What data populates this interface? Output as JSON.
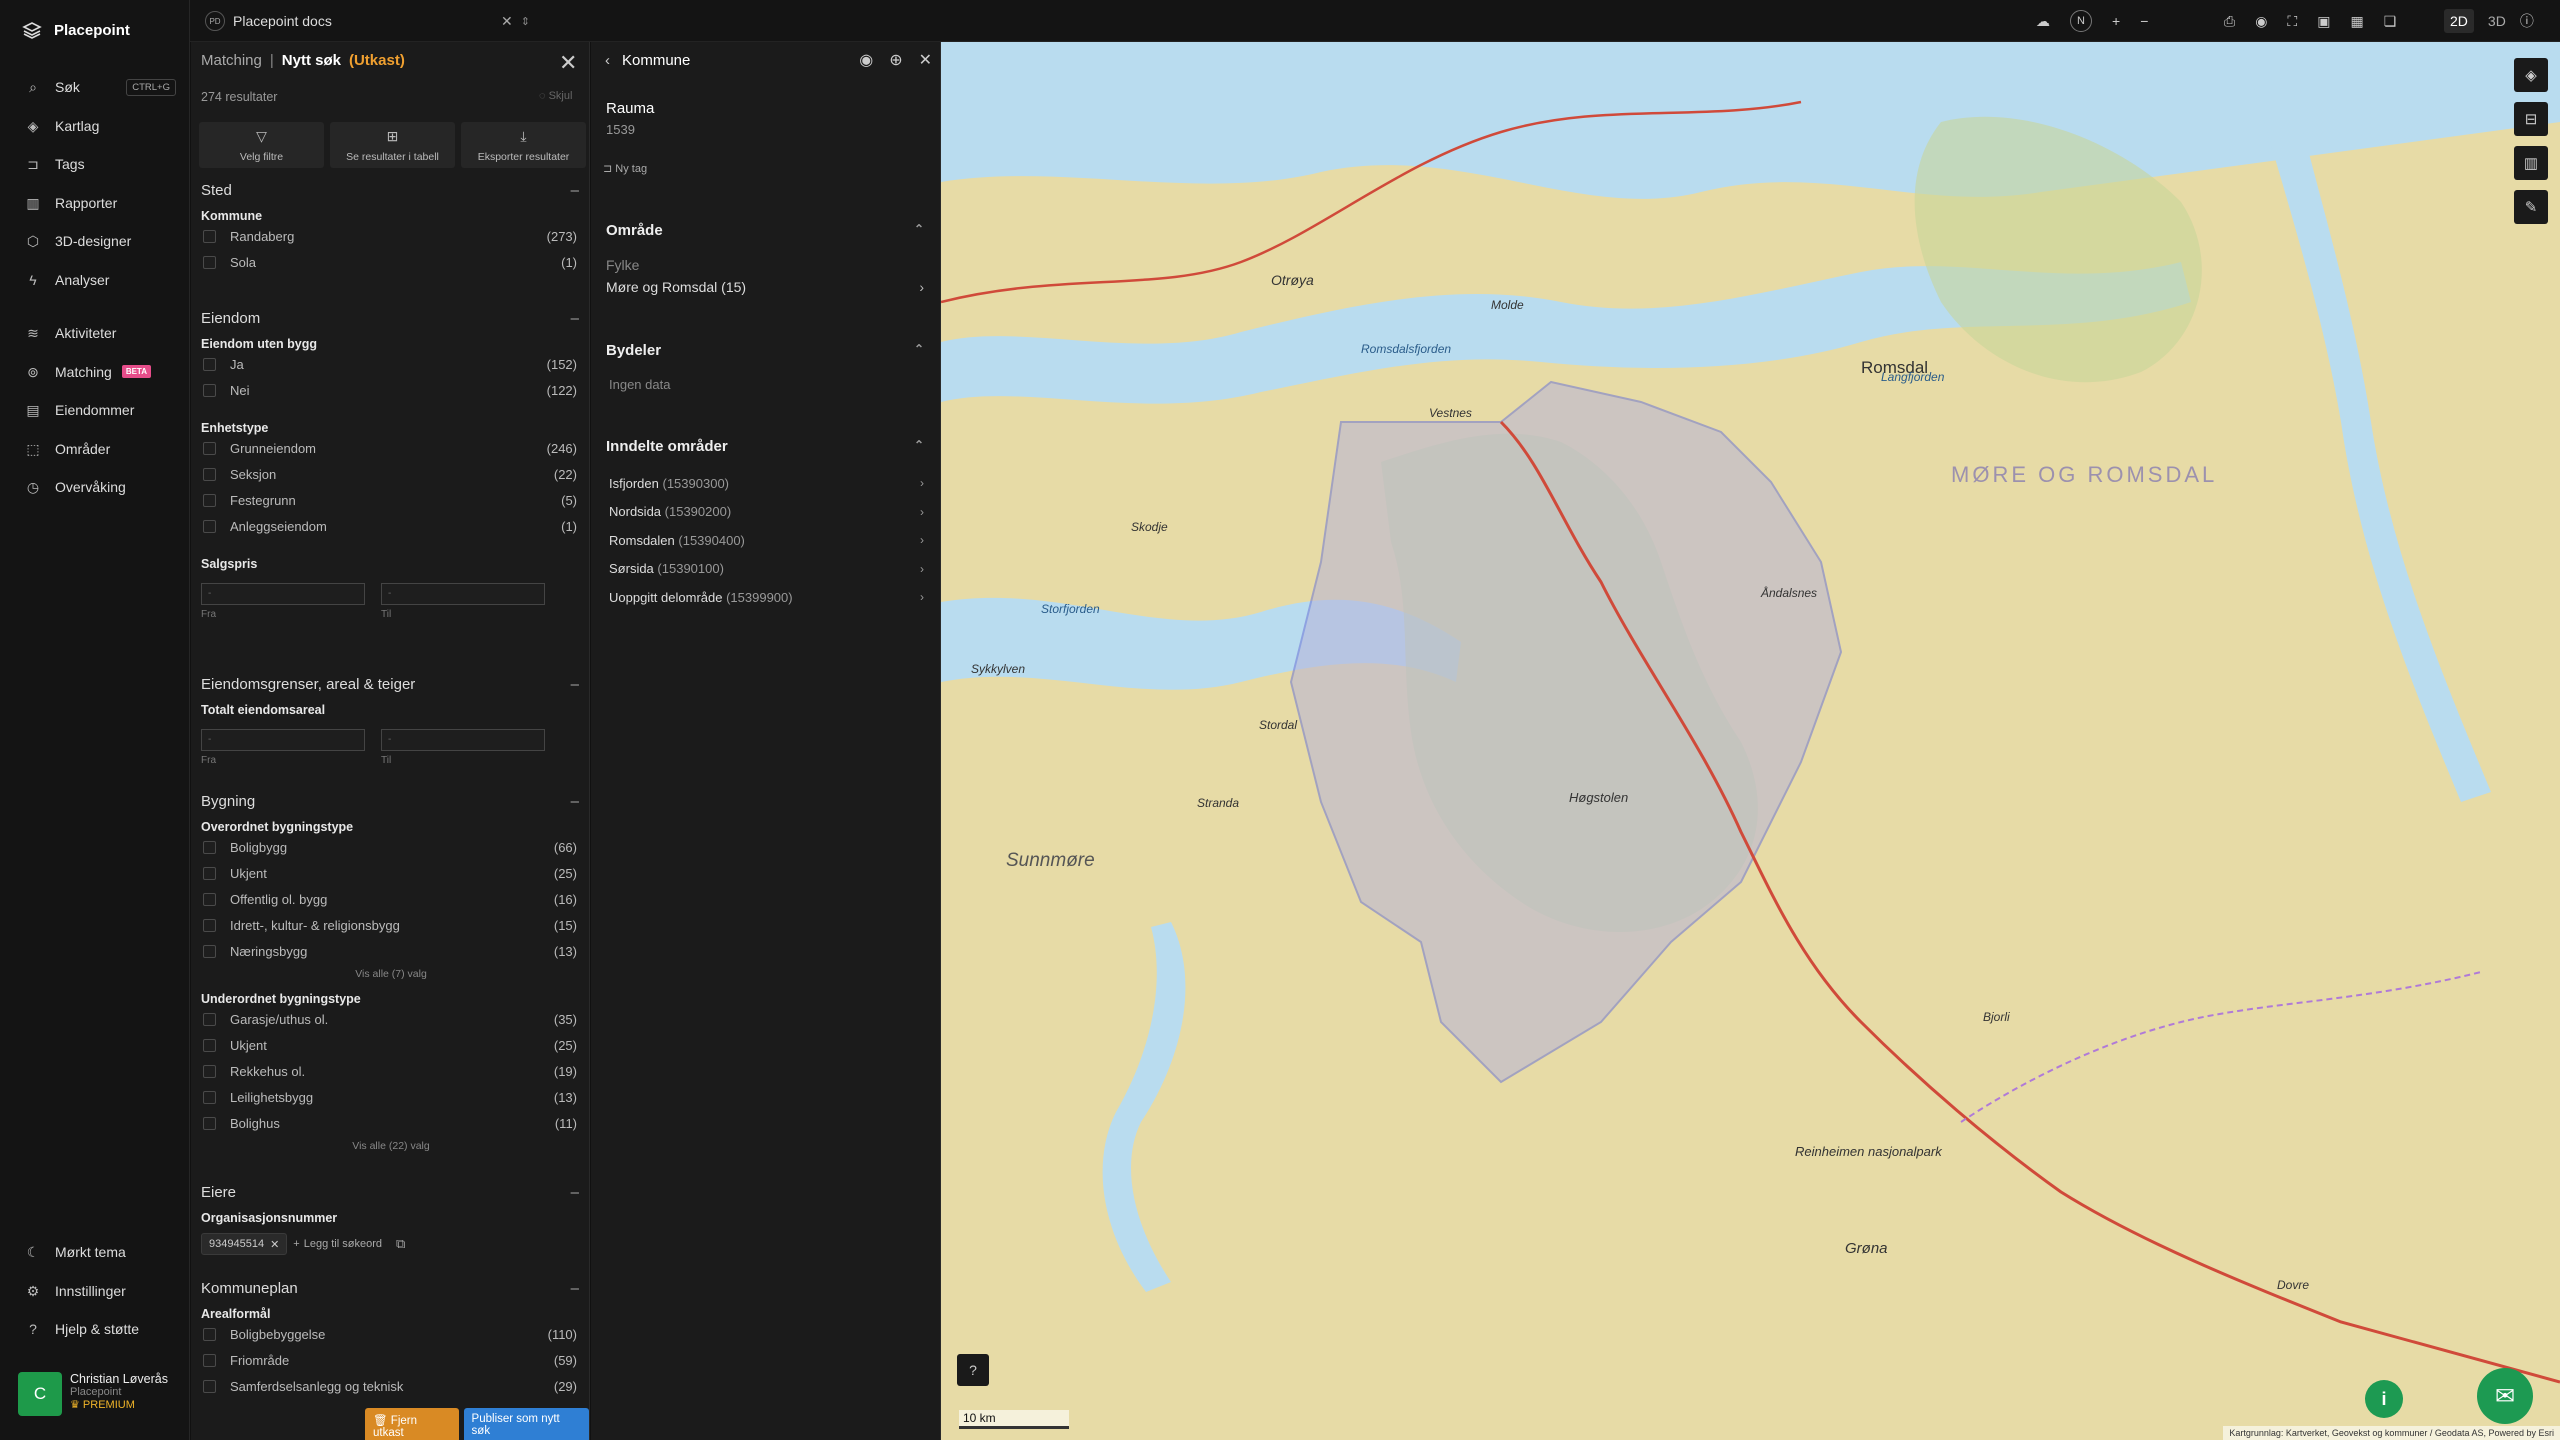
{
  "app": {
    "name": "Placepoint"
  },
  "sidebar": {
    "items": [
      {
        "label": "Søk",
        "shortcut": "CTRL+G",
        "icon": "search-icon"
      },
      {
        "label": "Kartlag",
        "icon": "layers-icon"
      },
      {
        "label": "Tags",
        "icon": "bookmark-icon"
      },
      {
        "label": "Rapporter",
        "icon": "chart-icon"
      },
      {
        "label": "3D-designer",
        "icon": "cube-icon"
      },
      {
        "label": "Analyser",
        "icon": "lightning-icon"
      },
      {
        "label": "Aktiviteter",
        "icon": "activity-icon"
      },
      {
        "label": "Matching",
        "badge": "BETA",
        "icon": "target-icon"
      },
      {
        "label": "Eiendommer",
        "icon": "building-icon"
      },
      {
        "label": "Områder",
        "icon": "area-icon"
      },
      {
        "label": "Overvåking",
        "icon": "monitor-icon"
      }
    ],
    "bottom": [
      {
        "label": "Mørkt tema",
        "icon": "moon-icon"
      },
      {
        "label": "Innstillinger",
        "icon": "gear-icon"
      },
      {
        "label": "Hjelp & støtte",
        "icon": "help-icon"
      }
    ],
    "user": {
      "initial": "C",
      "name": "Christian Løverås",
      "org": "Placepoint",
      "plan": "PREMIUM"
    }
  },
  "topbar": {
    "doc_badge": "PD",
    "doc_name": "Placepoint docs",
    "view_2d": "2D",
    "view_3d": "3D",
    "compass": "N"
  },
  "search": {
    "breadcrumb": "Matching",
    "title": "Nytt søk",
    "status": "(Utkast)",
    "count": "274 resultater",
    "hide": "Skjul",
    "actions": [
      "Velg filtre",
      "Se resultater i tabell",
      "Eksporter resultater"
    ],
    "sted": {
      "title": "Sted",
      "kommune_label": "Kommune",
      "options": [
        {
          "label": "Randaberg",
          "count": "(273)"
        },
        {
          "label": "Sola",
          "count": "(1)"
        }
      ]
    },
    "eiendom": {
      "title": "Eiendom",
      "uten_bygg_label": "Eiendom uten bygg",
      "uten_bygg": [
        {
          "label": "Ja",
          "count": "(152)"
        },
        {
          "label": "Nei",
          "count": "(122)"
        }
      ],
      "enhetstype_label": "Enhetstype",
      "enhetstype": [
        {
          "label": "Grunneiendom",
          "count": "(246)"
        },
        {
          "label": "Seksjon",
          "count": "(22)"
        },
        {
          "label": "Festegrunn",
          "count": "(5)"
        },
        {
          "label": "Anleggseiendom",
          "count": "(1)"
        }
      ],
      "salgspris_label": "Salgspris",
      "from": "Fra",
      "to": "Til",
      "dash": "-"
    },
    "grenser": {
      "title": "Eiendomsgrenser, areal & teiger",
      "areal_label": "Totalt eiendomsareal",
      "from": "Fra",
      "to": "Til",
      "dash": "-"
    },
    "bygning": {
      "title": "Bygning",
      "over_label": "Overordnet bygningstype",
      "over": [
        {
          "label": "Boligbygg",
          "count": "(66)"
        },
        {
          "label": "Ukjent",
          "count": "(25)"
        },
        {
          "label": "Offentlig ol. bygg",
          "count": "(16)"
        },
        {
          "label": "Idrett-, kultur- & religionsbygg",
          "count": "(15)"
        },
        {
          "label": "Næringsbygg",
          "count": "(13)"
        }
      ],
      "over_more": "Vis alle (7) valg",
      "under_label": "Underordnet bygningstype",
      "under": [
        {
          "label": "Garasje/uthus ol.",
          "count": "(35)"
        },
        {
          "label": "Ukjent",
          "count": "(25)"
        },
        {
          "label": "Rekkehus ol.",
          "count": "(19)"
        },
        {
          "label": "Leilighetsbygg",
          "count": "(13)"
        },
        {
          "label": "Bolighus",
          "count": "(11)"
        }
      ],
      "under_more": "Vis alle (22) valg"
    },
    "eiere": {
      "title": "Eiere",
      "org_label": "Organisasjonsnummer",
      "chip": "934945514",
      "add": "Legg til søkeord"
    },
    "kommuneplan": {
      "title": "Kommuneplan",
      "areal_label": "Arealformål",
      "options": [
        {
          "label": "Boligbebyggelse",
          "count": "(110)"
        },
        {
          "label": "Friområde",
          "count": "(59)"
        },
        {
          "label": "Samferdselsanlegg og teknisk",
          "count": "(29)"
        }
      ]
    },
    "btn_remove": "Fjern utkast",
    "btn_publish": "Publiser som nytt søk"
  },
  "detail": {
    "header": "Kommune",
    "name": "Rauma",
    "number": "1539",
    "new_tag": "Ny tag",
    "omrade": {
      "title": "Område",
      "fylke_label": "Fylke",
      "fylke": "Møre og Romsdal",
      "fylke_count": "(15)"
    },
    "bydeler": {
      "title": "Bydeler",
      "empty": "Ingen data"
    },
    "inndelte": {
      "title": "Inndelte områder",
      "items": [
        {
          "name": "Isfjorden",
          "code": "(15390300)"
        },
        {
          "name": "Nordsida",
          "code": "(15390200)"
        },
        {
          "name": "Romsdalen",
          "code": "(15390400)"
        },
        {
          "name": "Sørsida",
          "code": "(15390100)"
        },
        {
          "name": "Uoppgitt delområde",
          "code": "(15399900)"
        }
      ]
    }
  },
  "map": {
    "labels": [
      "Otrøya",
      "Molde",
      "Romsdal",
      "MØRE OG ROMSDAL",
      "Sunnmøre",
      "Vestnes",
      "Åndalsnes",
      "Romsdalsfjorden",
      "Langfjorden",
      "Storfjorden",
      "Høgstolen",
      "Reinheimen nasjonalpark",
      "Skodje",
      "Stordal",
      "Stranda",
      "Sykkylven",
      "Bjorli",
      "Grøna",
      "Dovre"
    ],
    "scale": "10 km",
    "attribution": "Kartgrunnlag: Kartverket, Geovekst og kommuner / Geodata AS, Powered by Esri",
    "colors": {
      "land": "#e8dcaa",
      "water": "#b9dcef",
      "forest": "#c9d99a",
      "selected": "#b7b4d8"
    }
  }
}
